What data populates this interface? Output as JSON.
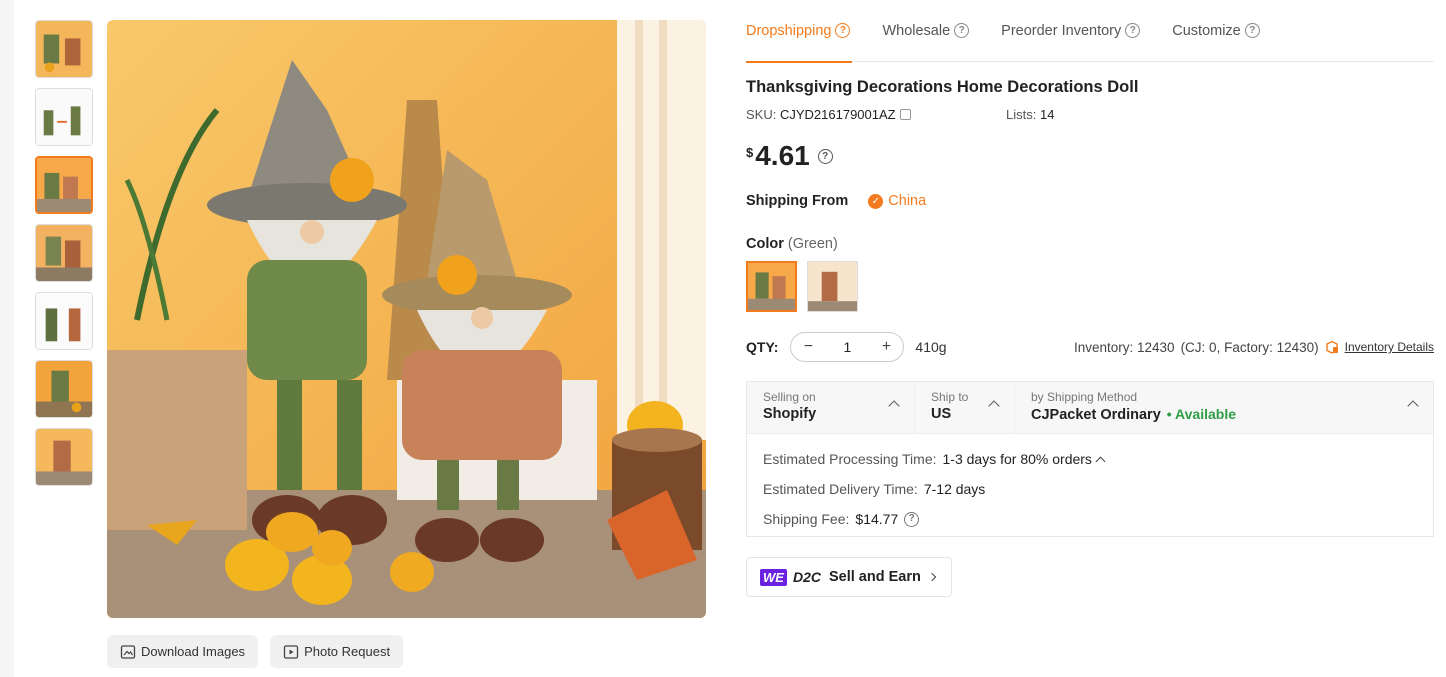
{
  "tabs": [
    {
      "label": "Dropshipping",
      "active": true
    },
    {
      "label": "Wholesale",
      "active": false
    },
    {
      "label": "Preorder Inventory",
      "active": false
    },
    {
      "label": "Customize",
      "active": false
    }
  ],
  "product": {
    "title": "Thanksgiving Decorations Home Decorations Doll",
    "sku_label": "SKU:",
    "sku": "CJYD216179001AZ",
    "lists_label": "Lists:",
    "lists": "14",
    "currency": "$",
    "price": "4.61"
  },
  "shipping_from": {
    "label": "Shipping From",
    "country": "China"
  },
  "color": {
    "label": "Color",
    "selected": "(Green)"
  },
  "qty": {
    "label": "QTY:",
    "value": "1",
    "weight": "410g"
  },
  "inventory": {
    "text": "Inventory: 12430",
    "detail": "(CJ: 0, Factory: 12430)",
    "link": "Inventory Details"
  },
  "shipping": {
    "selling_on_label": "Selling on",
    "selling_on": "Shopify",
    "ship_to_label": "Ship to",
    "ship_to": "US",
    "method_label": "by Shipping Method",
    "method": "CJPacket Ordinary",
    "availability": "• Available",
    "processing_label": "Estimated Processing Time:",
    "processing": "1-3 days for 80% orders",
    "delivery_label": "Estimated Delivery Time:",
    "delivery": "7-12 days",
    "fee_label": "Shipping Fee:",
    "fee": "$14.77"
  },
  "d2c": {
    "we": "WE",
    "d2c": "D2C",
    "label": "Sell and Earn"
  },
  "image_buttons": {
    "download": "Download Images",
    "photo": "Photo Request"
  },
  "colors": {
    "accent": "#f37b1d",
    "available": "#2e9e44",
    "we_badge": "#6b21e0"
  },
  "icons": [
    "question-icon",
    "check-icon",
    "copy-icon",
    "minus-icon",
    "plus-icon",
    "box-icon",
    "chevron-up-icon",
    "download-image-icon",
    "photo-request-icon"
  ]
}
